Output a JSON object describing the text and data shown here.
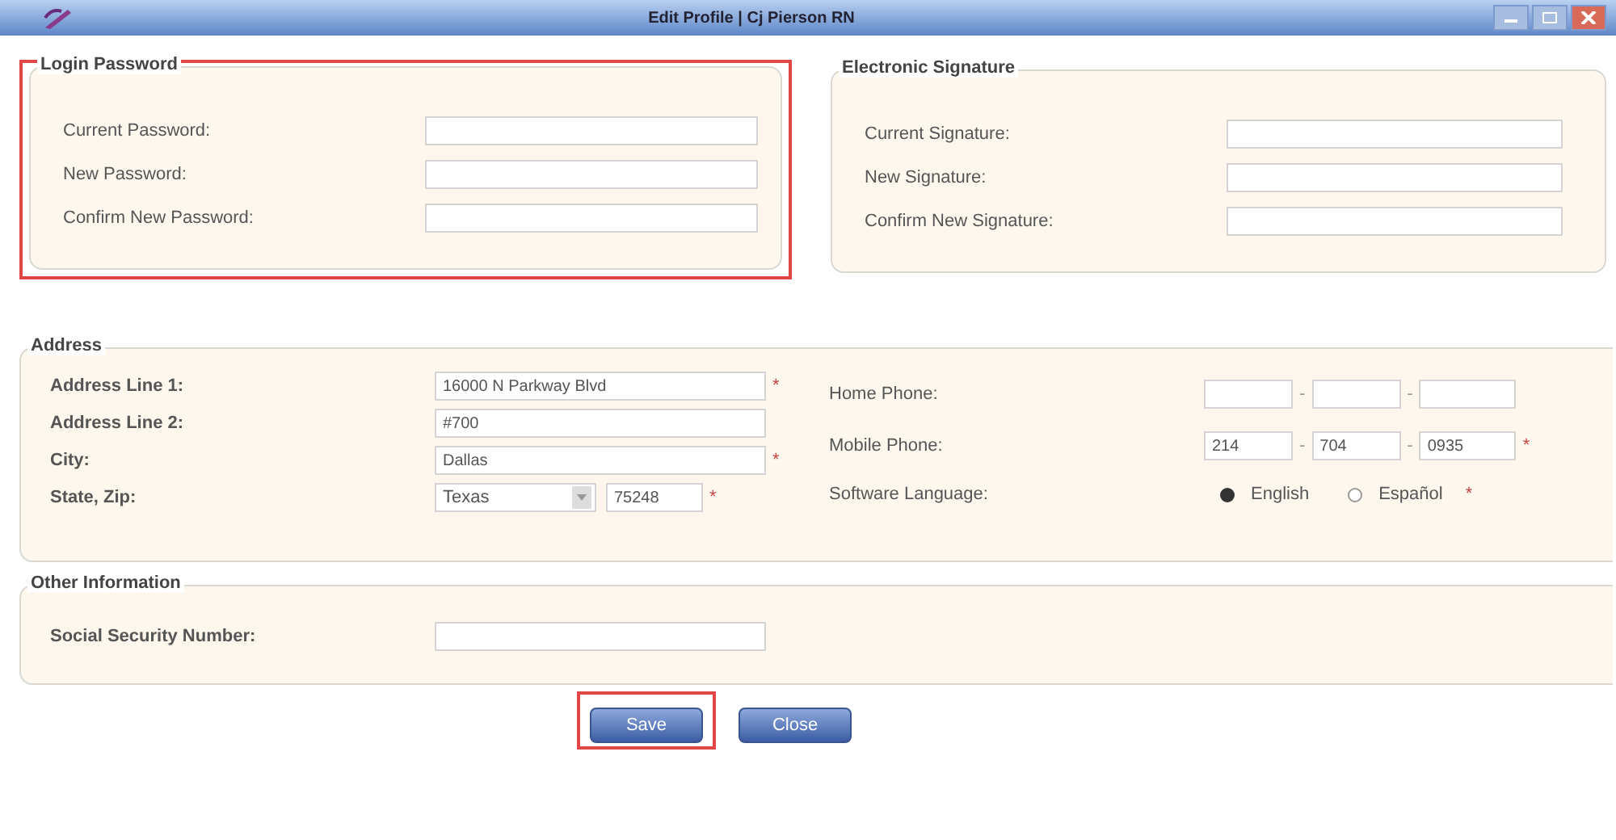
{
  "window": {
    "title": "Edit Profile | Cj Pierson RN"
  },
  "login_password": {
    "title": "Login Password",
    "highlighted": true,
    "fields": [
      {
        "label": "Current Password:"
      },
      {
        "label": "New Password:"
      },
      {
        "label": "Confirm New Password:"
      }
    ]
  },
  "electronic_signature": {
    "title": "Electronic Signature",
    "highlighted": false,
    "fields": [
      {
        "label": "Current Signature:"
      },
      {
        "label": "New Signature:"
      },
      {
        "label": "Confirm New Signature:"
      }
    ]
  },
  "address": {
    "title": "Address",
    "rows": [
      {
        "label": "Address Line 1:",
        "kind": "text",
        "value": "16000 N Parkway Blvd",
        "mark": "*"
      },
      {
        "label": "Address Line 2:",
        "kind": "text",
        "value": "#700"
      },
      {
        "label": "City:",
        "kind": "text",
        "value": "Dallas",
        "mark": "*"
      },
      {
        "label": "State, Zip:",
        "kind": "state_zip",
        "state": "Texas",
        "zip": "75248",
        "mark": "*"
      }
    ],
    "side_rows": [
      {
        "label": "Home Phone:",
        "kind": "phone",
        "separator": "-",
        "parts": []
      },
      {
        "label": "Mobile Phone:",
        "kind": "phone",
        "separator": "-",
        "parts": [
          "214",
          "704",
          "0935"
        ],
        "mark": "*"
      },
      {
        "label": "Software Language:",
        "kind": "radio",
        "options": [
          {
            "label": "English",
            "selected": true
          },
          {
            "label": "Español",
            "selected": false
          }
        ],
        "mark": "*"
      }
    ]
  },
  "other_information": {
    "title": "Other Information",
    "fields": [
      {
        "label": "Social Security Number:"
      }
    ]
  },
  "buttons": [
    {
      "label": "Save",
      "highlighted": true
    },
    {
      "label": "Close",
      "highlighted": false
    }
  ]
}
